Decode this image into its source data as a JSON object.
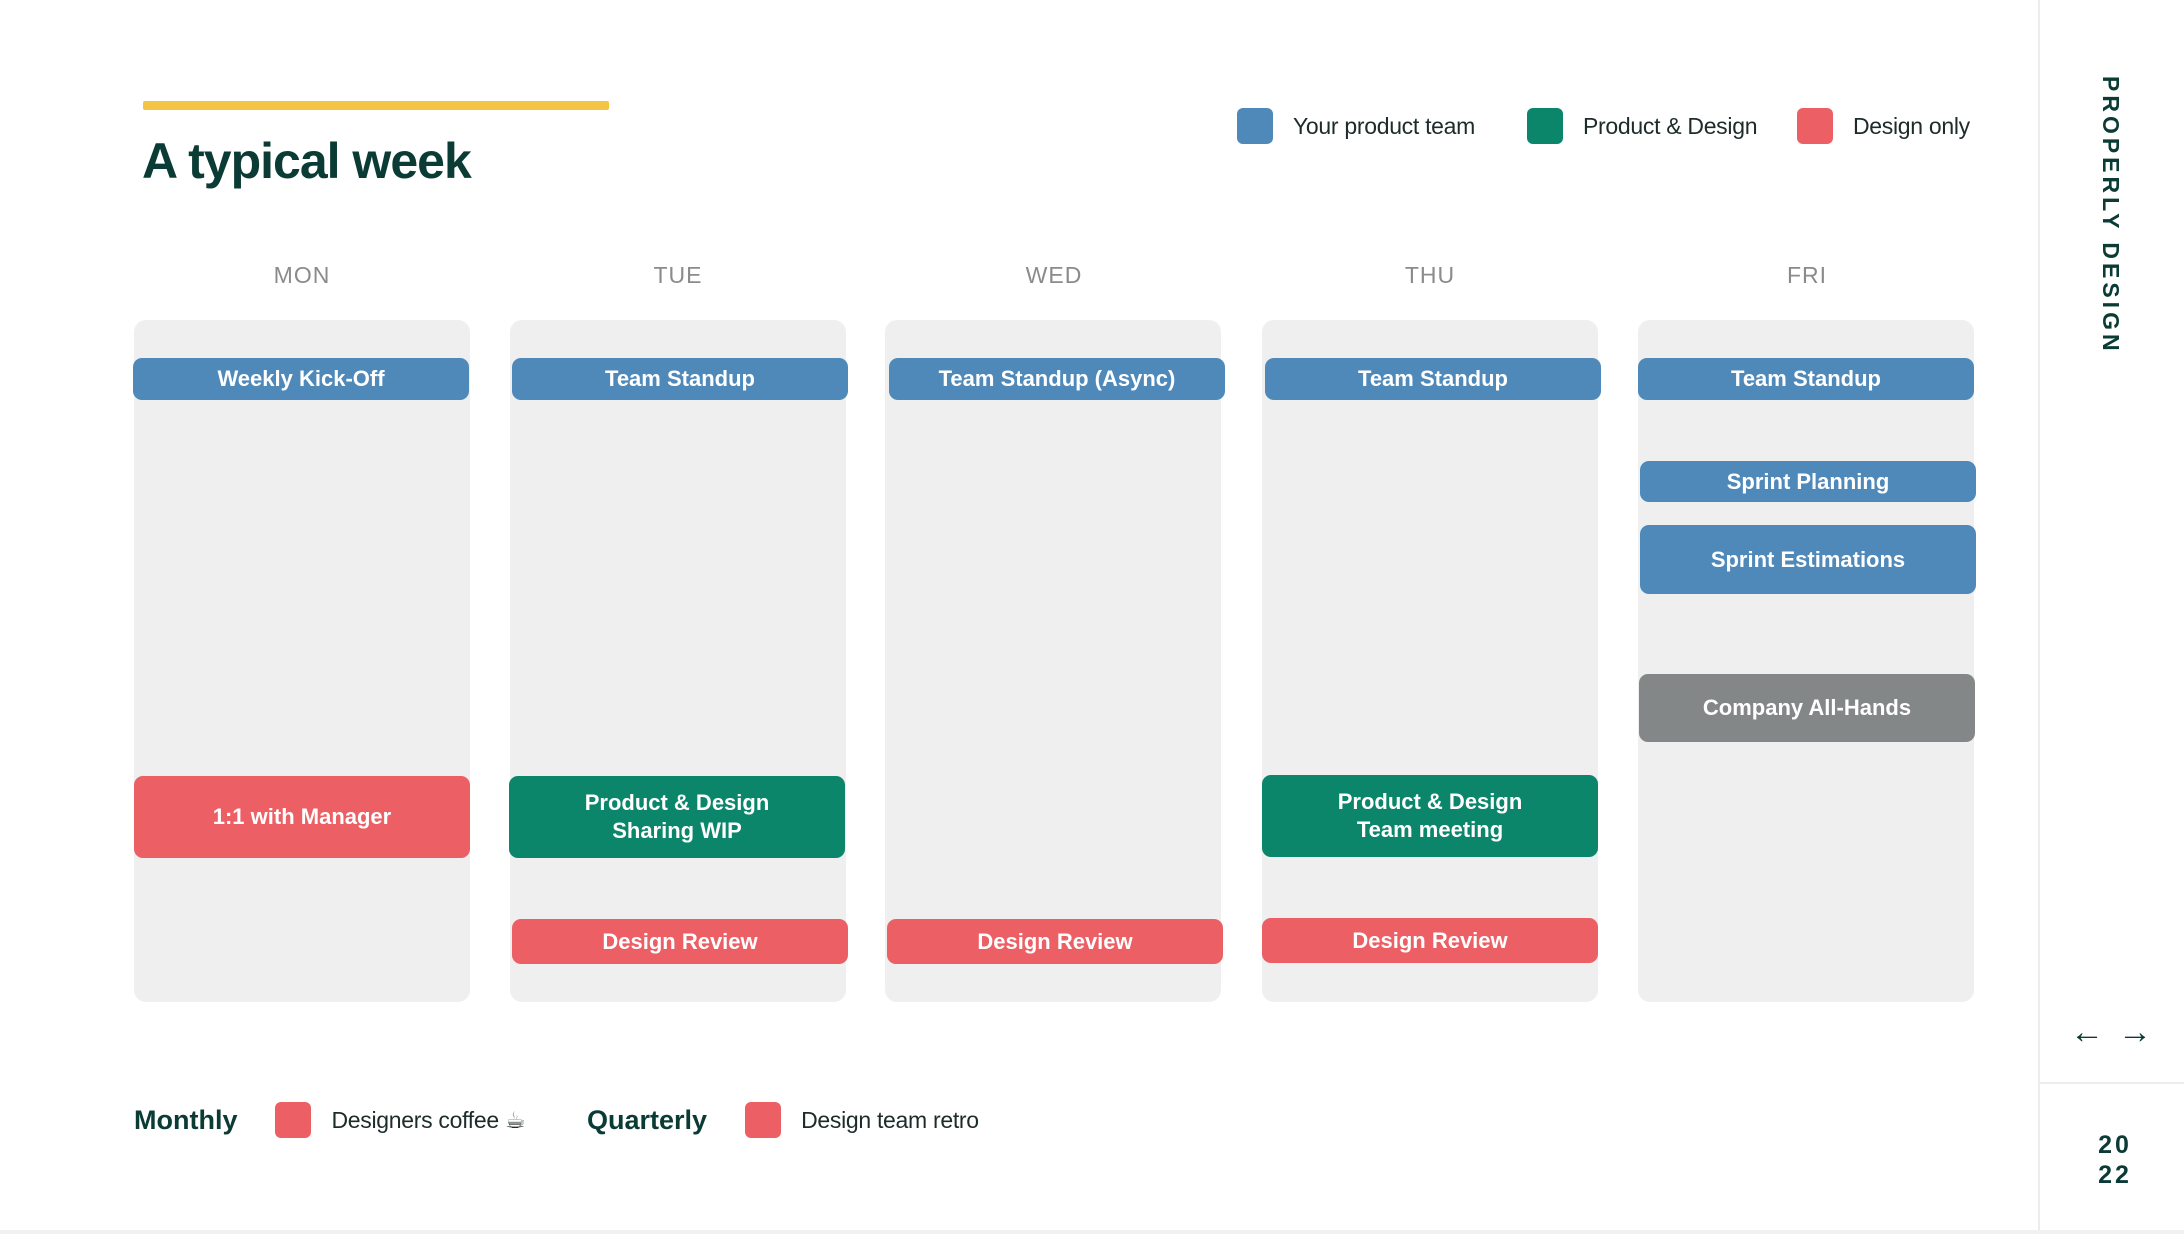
{
  "header": {
    "title": "A typical week"
  },
  "legend": [
    {
      "label": "Your product team",
      "color": "#4f89ba"
    },
    {
      "label": "Product & Design",
      "color": "#0b866b"
    },
    {
      "label": "Design only",
      "color": "#ec5f65"
    }
  ],
  "days": [
    {
      "label": "MON",
      "events": [
        {
          "label": "Weekly Kick-Off",
          "category": "product-team"
        },
        {
          "label": "1:1 with Manager",
          "category": "design-only"
        }
      ]
    },
    {
      "label": "TUE",
      "events": [
        {
          "label": "Team Standup",
          "category": "product-team"
        },
        {
          "label": "Product & Design\nSharing WIP",
          "category": "product-design"
        },
        {
          "label": "Design Review",
          "category": "design-only"
        }
      ]
    },
    {
      "label": "WED",
      "events": [
        {
          "label": "Team Standup (Async)",
          "category": "product-team"
        },
        {
          "label": "Design Review",
          "category": "design-only"
        }
      ]
    },
    {
      "label": "THU",
      "events": [
        {
          "label": "Team Standup",
          "category": "product-team"
        },
        {
          "label": "Product & Design\nTeam meeting",
          "category": "product-design"
        },
        {
          "label": "Design Review",
          "category": "design-only"
        }
      ]
    },
    {
      "label": "FRI",
      "events": [
        {
          "label": "Team Standup",
          "category": "product-team"
        },
        {
          "label": "Sprint Planning",
          "category": "product-team"
        },
        {
          "label": "Sprint Estimations",
          "category": "product-team"
        },
        {
          "label": "Company All-Hands",
          "category": "company",
          "color": "#848788"
        }
      ]
    }
  ],
  "recurring": [
    {
      "period": "Monthly",
      "label": "Designers coffee ☕",
      "color": "#ec5f65"
    },
    {
      "period": "Quarterly",
      "label": "Design team retro",
      "color": "#ec5f65"
    }
  ],
  "sidebar": {
    "brand": "PROPERLY DESIGN",
    "prev_icon": "arrow-left-icon",
    "next_icon": "arrow-right-icon",
    "prev_glyph": "←",
    "next_glyph": "→",
    "year_top": "20",
    "year_bottom": "22"
  }
}
